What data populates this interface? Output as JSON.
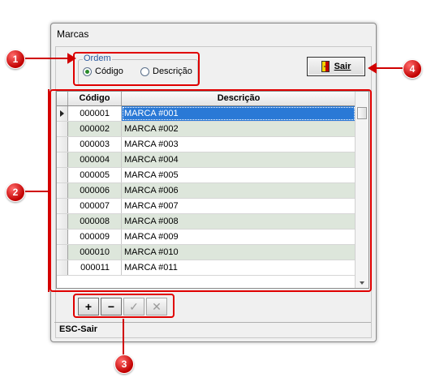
{
  "window": {
    "title": "Marcas"
  },
  "order": {
    "group_label": "Ordem",
    "options": [
      {
        "label": "Código",
        "checked": true
      },
      {
        "label": "Descrição",
        "checked": false
      }
    ]
  },
  "exit_button": {
    "label": "Sair",
    "icon": "door-exit-icon"
  },
  "grid": {
    "columns": [
      "Código",
      "Descrição"
    ],
    "rows": [
      {
        "code": "000001",
        "desc": "MARCA #001"
      },
      {
        "code": "000002",
        "desc": "MARCA #002"
      },
      {
        "code": "000003",
        "desc": "MARCA #003"
      },
      {
        "code": "000004",
        "desc": "MARCA #004"
      },
      {
        "code": "000005",
        "desc": "MARCA #005"
      },
      {
        "code": "000006",
        "desc": "MARCA #006"
      },
      {
        "code": "000007",
        "desc": "MARCA #007"
      },
      {
        "code": "000008",
        "desc": "MARCA #008"
      },
      {
        "code": "000009",
        "desc": "MARCA #009"
      },
      {
        "code": "000010",
        "desc": "MARCA #010"
      },
      {
        "code": "000011",
        "desc": "MARCA #011"
      }
    ]
  },
  "toolbar": {
    "buttons": [
      {
        "symbol": "+",
        "icon": "plus-icon",
        "enabled": true
      },
      {
        "symbol": "−",
        "icon": "minus-icon",
        "enabled": true
      },
      {
        "symbol": "✓",
        "icon": "check-icon",
        "enabled": false
      },
      {
        "symbol": "✕",
        "icon": "cancel-icon",
        "enabled": false
      }
    ]
  },
  "status_bar": {
    "text": "ESC-Sair"
  },
  "callouts": {
    "c1": "1",
    "c2": "2",
    "c3": "3",
    "c4": "4"
  },
  "colors": {
    "callout": "#c10000",
    "selection": "#2a79d6",
    "alt_row": "#dde6db"
  }
}
